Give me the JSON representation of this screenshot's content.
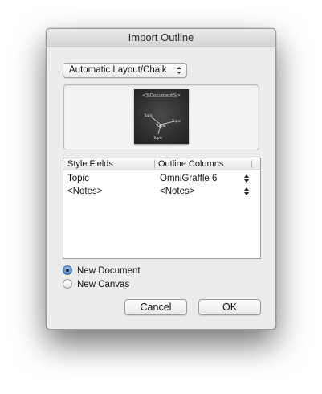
{
  "window": {
    "title": "Import Outline"
  },
  "template_popup": {
    "selected": "Automatic Layout/Chalk"
  },
  "preview": {
    "title_text": "<%Document%>",
    "nodes": [
      "Topic",
      "Topic",
      "Topic",
      "Topic"
    ]
  },
  "table": {
    "headers": [
      "Style Fields",
      "Outline Columns"
    ],
    "rows": [
      {
        "field": "Topic",
        "column": "OmniGraffle 6"
      },
      {
        "field": "<Notes>",
        "column": "<Notes>"
      }
    ]
  },
  "options": {
    "new_document": "New Document",
    "new_canvas": "New Canvas",
    "selected": "new_document"
  },
  "buttons": {
    "cancel": "Cancel",
    "ok": "OK"
  }
}
